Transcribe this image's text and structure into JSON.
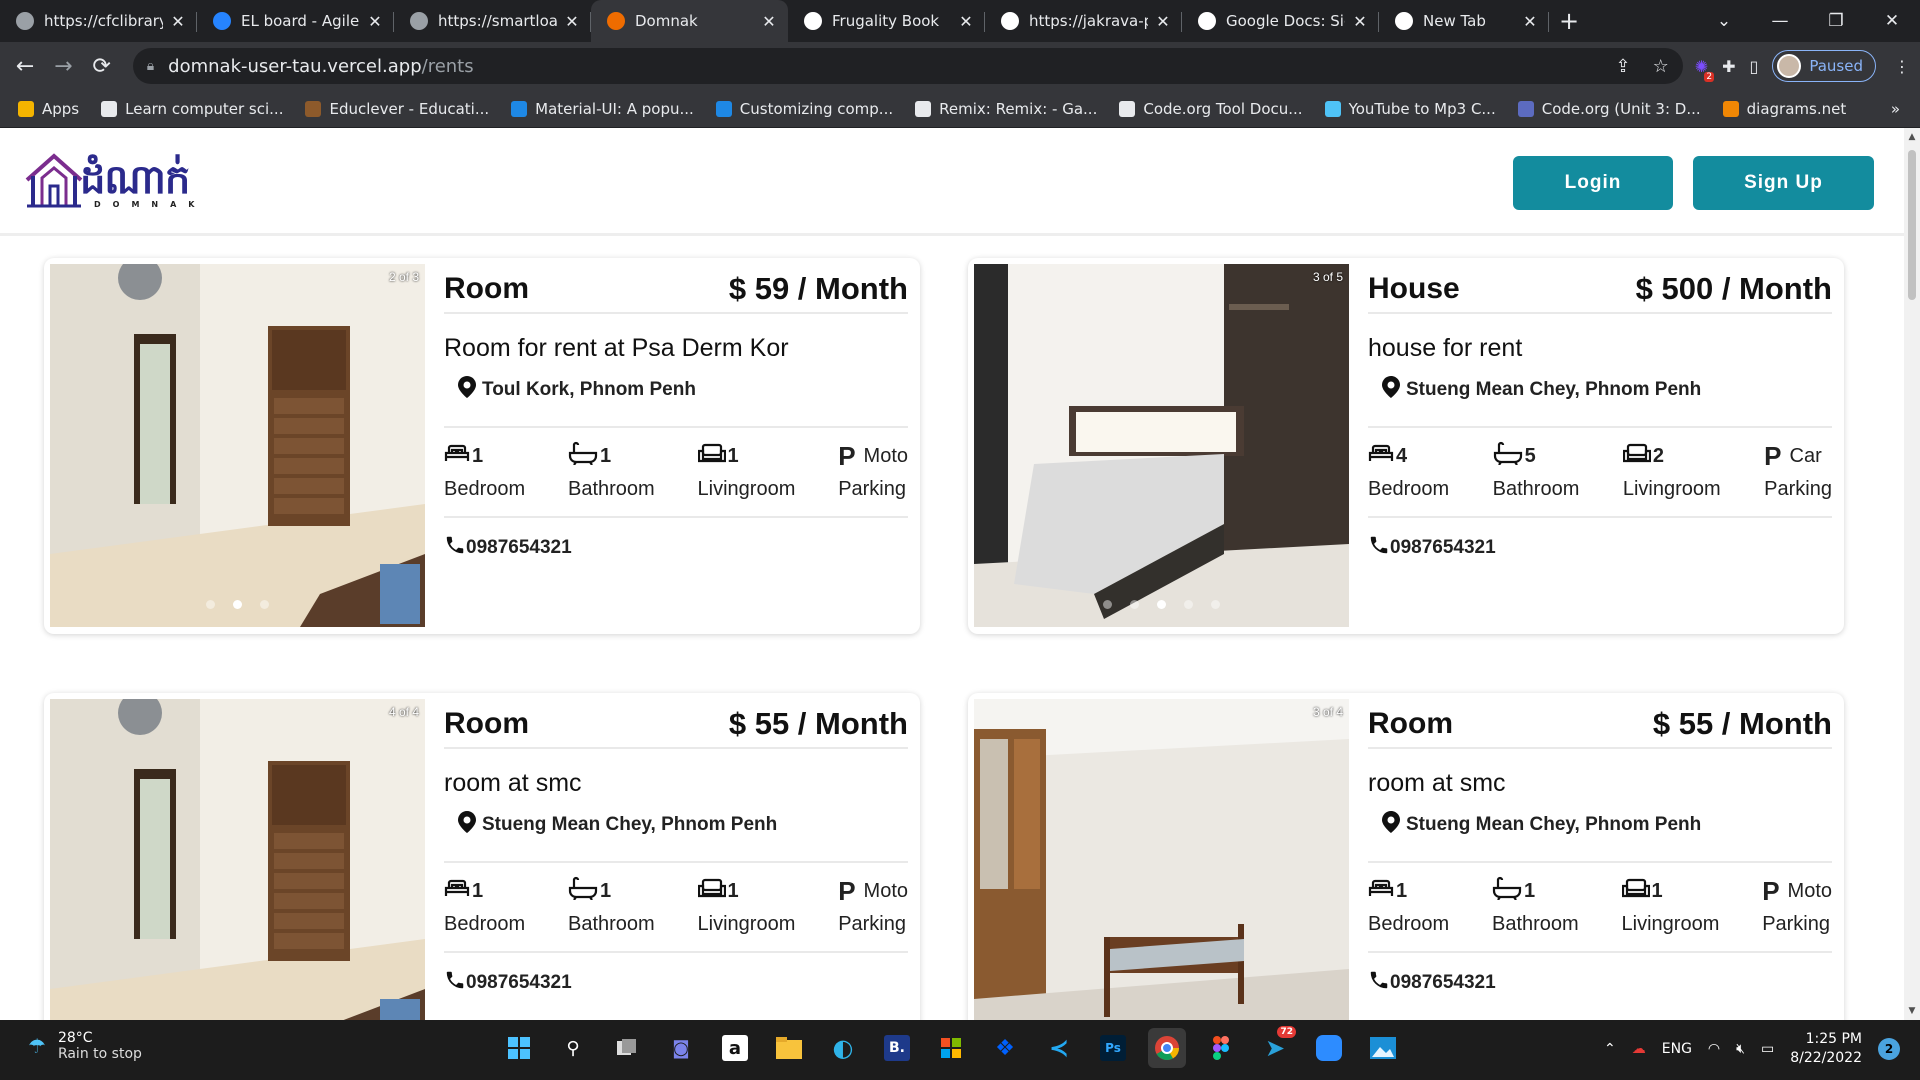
{
  "browser": {
    "tabs": [
      {
        "title": "https://cfclibrary.",
        "active": false,
        "fav": "#9aa0a6"
      },
      {
        "title": "EL board - Agile b",
        "active": false,
        "fav": "#2684ff"
      },
      {
        "title": "https://smartload",
        "active": false,
        "fav": "#9aa0a6"
      },
      {
        "title": "Domnak",
        "active": true,
        "fav": "#ef6c00"
      },
      {
        "title": "Frugality Book",
        "active": false,
        "fav": "#ffffff"
      },
      {
        "title": "https://jakrava-pl",
        "active": false,
        "fav": "#ffffff"
      },
      {
        "title": "Google Docs: Sig",
        "active": false,
        "fav": "#ffffff"
      },
      {
        "title": "New Tab",
        "active": false,
        "fav": "#ffffff"
      }
    ],
    "url_host": "domnak-user-tau.vercel.app",
    "url_path": "/rents",
    "profile_label": "Paused",
    "ext_badge": "2",
    "bookmarks": [
      {
        "label": "Apps",
        "color": "#f4b400"
      },
      {
        "label": "Learn computer sci...",
        "color": "#e8eaed"
      },
      {
        "label": "Educlever - Educati...",
        "color": "#8d5a2b"
      },
      {
        "label": "Material-UI: A popu...",
        "color": "#1e88e5"
      },
      {
        "label": "Customizing comp...",
        "color": "#1e88e5"
      },
      {
        "label": "Remix: Remix: - Ga...",
        "color": "#e8eaed"
      },
      {
        "label": "Code.org Tool Docu...",
        "color": "#e8eaed"
      },
      {
        "label": "YouTube to Mp3 C...",
        "color": "#4fc3f7"
      },
      {
        "label": "Code.org (Unit 3: D...",
        "color": "#5c6bc0"
      },
      {
        "label": "diagrams.net",
        "color": "#f08705"
      }
    ],
    "bookmarks_more": "»"
  },
  "site": {
    "logo_text": "ដំណាក់",
    "logo_sub": "DOMNAK",
    "login_label": "Login",
    "signup_label": "Sign Up"
  },
  "listings": [
    {
      "type": "Room",
      "price": "$ 59 / Month",
      "title": "Room for rent at Psa Derm Kor",
      "location": "Toul Kork, Phnom Penh",
      "bedroom": "1",
      "bathroom": "1",
      "livingroom": "1",
      "parking": "Moto",
      "phone": "0987654321",
      "counter": "2 of 3",
      "dots": 3,
      "active_dot": 1,
      "labels": {
        "bed": "Bedroom",
        "bath": "Bathroom",
        "living": "Livingroom",
        "park": "Parking"
      }
    },
    {
      "type": "House",
      "price": "$ 500 / Month",
      "title": "house for rent",
      "location": "Stueng Mean Chey, Phnom Penh",
      "bedroom": "4",
      "bathroom": "5",
      "livingroom": "2",
      "parking": "Car",
      "phone": "0987654321",
      "counter": "3 of 5",
      "dots": 5,
      "active_dot": 2,
      "labels": {
        "bed": "Bedroom",
        "bath": "Bathroom",
        "living": "Livingroom",
        "park": "Parking"
      }
    },
    {
      "type": "Room",
      "price": "$ 55 / Month",
      "title": "room at smc",
      "location": "Stueng Mean Chey, Phnom Penh",
      "bedroom": "1",
      "bathroom": "1",
      "livingroom": "1",
      "parking": "Moto",
      "phone": "0987654321",
      "counter": "4 of 4",
      "dots": 4,
      "active_dot": 3,
      "labels": {
        "bed": "Bedroom",
        "bath": "Bathroom",
        "living": "Livingroom",
        "park": "Parking"
      }
    },
    {
      "type": "Room",
      "price": "$ 55 / Month",
      "title": "room at smc",
      "location": "Stueng Mean Chey, Phnom Penh",
      "bedroom": "1",
      "bathroom": "1",
      "livingroom": "1",
      "parking": "Moto",
      "phone": "0987654321",
      "counter": "3 of 4",
      "dots": 4,
      "active_dot": 2,
      "labels": {
        "bed": "Bedroom",
        "bath": "Bathroom",
        "living": "Livingroom",
        "park": "Parking"
      }
    }
  ],
  "taskbar": {
    "temp": "28°C",
    "weather": "Rain to stop",
    "lang": "ENG",
    "time": "1:25 PM",
    "date": "8/22/2022",
    "notifications": "2",
    "telegram_badge": "72",
    "bold_icon_b": "B.",
    "ps_label": "Ps",
    "amazon_label": "a"
  }
}
